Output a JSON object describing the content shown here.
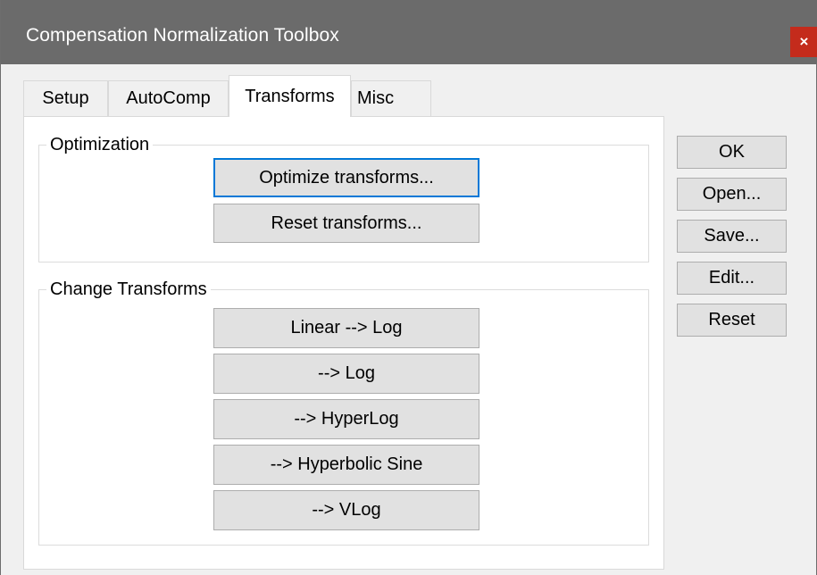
{
  "window": {
    "title": "Compensation Normalization Toolbox",
    "close_glyph": "×"
  },
  "tabs": [
    {
      "label": "Setup",
      "active": false
    },
    {
      "label": "AutoComp",
      "active": false
    },
    {
      "label": "Transforms",
      "active": true
    },
    {
      "label": "Misc",
      "active": false
    }
  ],
  "optimization": {
    "title": "Optimization",
    "optimize_label": "Optimize transforms...",
    "reset_label": "Reset transforms..."
  },
  "change_transforms": {
    "title": "Change Transforms",
    "buttons": [
      "Linear --> Log",
      "--> Log",
      "--> HyperLog",
      "--> Hyperbolic Sine",
      "--> VLog"
    ]
  },
  "side_buttons": {
    "ok": "OK",
    "open": "Open...",
    "save": "Save...",
    "edit": "Edit...",
    "reset": "Reset"
  },
  "colors": {
    "titlebar": "#6b6b6b",
    "close": "#c42b1c",
    "focus": "#0078d7"
  }
}
